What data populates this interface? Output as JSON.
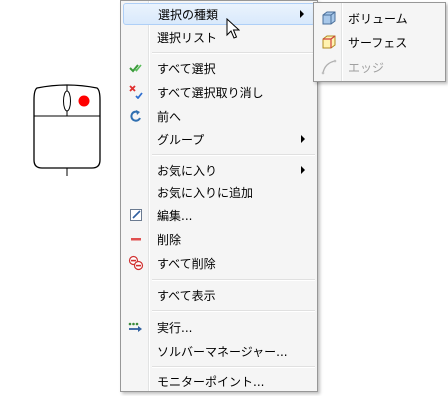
{
  "menu": {
    "items": [
      {
        "label": "選択の種類",
        "icon": "none",
        "submenu": true,
        "highlighted": true
      },
      {
        "label": "選択リスト",
        "icon": "none",
        "submenu": false
      },
      {
        "label": "すべて選択",
        "icon": "check-all-icon",
        "submenu": false
      },
      {
        "label": "すべて選択取り消し",
        "icon": "unselect-all-icon",
        "submenu": false
      },
      {
        "label": "前へ",
        "icon": "previous-icon",
        "submenu": false
      },
      {
        "label": "グループ",
        "icon": "none",
        "submenu": true
      },
      {
        "label": "お気に入り",
        "icon": "none",
        "submenu": true
      },
      {
        "label": "お気に入りに追加",
        "icon": "none",
        "submenu": false
      },
      {
        "label": "編集...",
        "icon": "edit-icon",
        "submenu": false
      },
      {
        "label": "削除",
        "icon": "delete-icon",
        "submenu": false
      },
      {
        "label": "すべて削除",
        "icon": "delete-all-icon",
        "submenu": false
      },
      {
        "label": "すべて表示",
        "icon": "none",
        "submenu": false
      },
      {
        "label": "実行...",
        "icon": "run-icon",
        "submenu": false
      },
      {
        "label": "ソルバーマネージャー...",
        "icon": "none",
        "submenu": false
      },
      {
        "label": "モニターポイント...",
        "icon": "none",
        "submenu": false
      }
    ]
  },
  "submenu": {
    "items": [
      {
        "label": "ボリューム",
        "icon": "volume-cube-icon",
        "enabled": true
      },
      {
        "label": "サーフェス",
        "icon": "surface-cube-icon",
        "enabled": true
      },
      {
        "label": "エッジ",
        "icon": "edge-curve-icon",
        "enabled": false
      }
    ]
  },
  "colors": {
    "highlight": "#d9e9fb",
    "menu_bg": "#f5f5f5",
    "mouse_button": "#ff0000"
  }
}
